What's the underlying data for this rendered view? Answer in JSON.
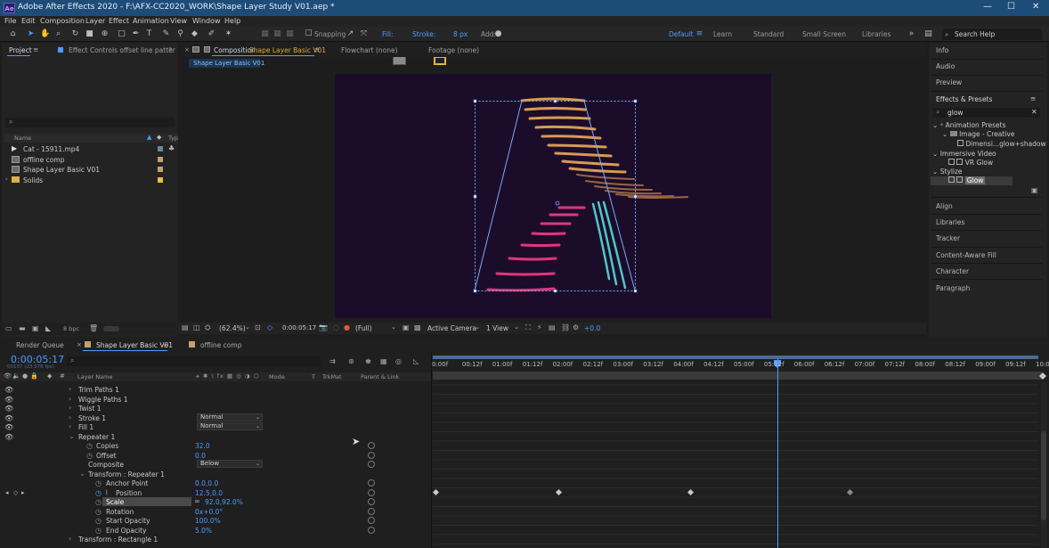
{
  "window": {
    "app_logo": "Ae",
    "title": "Adobe After Effects 2020 - F:\\AFX-CC2020_WORK\\Shape Layer Study V01.aep *"
  },
  "menu": [
    "File",
    "Edit",
    "Composition",
    "Layer",
    "Effect",
    "Animation",
    "View",
    "Window",
    "Help"
  ],
  "toolbar": {
    "snapping": "Snapping",
    "fill": "Fill:",
    "stroke": "Stroke:",
    "stroke_px": "8 px",
    "add": "Add:",
    "workspaces": [
      "Default",
      "Learn",
      "Standard",
      "Small Screen",
      "Libraries"
    ],
    "search_help": "Search Help"
  },
  "project": {
    "tab_project": "Project",
    "tab_effect_controls": "Effect Controls offset line patter",
    "col_name": "Name",
    "col_type": "Typ",
    "items": [
      {
        "name": "Cat - 15911.mp4",
        "color": "#5f8f8f"
      },
      {
        "name": "offline comp",
        "color": "#c7a06e"
      },
      {
        "name": "Shape Layer Basic V01",
        "color": "#c7a06e"
      },
      {
        "name": "Solids",
        "color": "#e3c23c"
      }
    ],
    "bpc": "8 bpc"
  },
  "viewer": {
    "tab_comp_prefix": "Composition",
    "tab_comp_name": "Shape Layer Basic V01",
    "tab_flowchart": "Flowchart (none)",
    "tab_footage": "Footage (none)",
    "breadcrumb": "Shape Layer Basic V01",
    "zoom": "(62.4%)",
    "time": "0:00:05:17",
    "resolution": "(Full)",
    "camera": "Active Camera",
    "view_count": "1 View",
    "exposure": "+0.0"
  },
  "right_panel": {
    "top_items": [
      "Info",
      "Audio",
      "Preview"
    ],
    "effects_title": "Effects & Presets",
    "search_value": "glow",
    "tree": [
      "Animation Presets",
      "Image - Creative",
      "Dimensi...glow+shadow",
      "Immersive Video",
      "VR Glow",
      "Stylize",
      "Glow"
    ],
    "bottom_items": [
      "Align",
      "Libraries",
      "Tracker",
      "Content-Aware Fill",
      "Character",
      "Paragraph"
    ]
  },
  "timeline": {
    "tab_render": "Render Queue",
    "tab_comp": "Shape Layer Basic V01",
    "tab_offline": "offline comp",
    "timecode": "0:00:05:17",
    "fps": "00137 (23.976 fps)",
    "col_layer": "Layer Name",
    "col_mode": "Mode",
    "col_t": "T",
    "col_trkmat": "TrkMat",
    "col_parent": "Parent & Link",
    "rows": [
      {
        "name": "Trim Paths 1"
      },
      {
        "name": "Wiggle Paths 1"
      },
      {
        "name": "Twist 1"
      },
      {
        "name": "Stroke 1",
        "mode": "Normal"
      },
      {
        "name": "Fill 1",
        "mode": "Normal"
      },
      {
        "name": "Repeater 1"
      },
      {
        "name": "Copies",
        "value": "32.0"
      },
      {
        "name": "Offset",
        "value": "0.0"
      },
      {
        "name": "Composite",
        "mode": "Below"
      },
      {
        "name": "Transform : Repeater 1"
      },
      {
        "name": "Anchor Point",
        "value": "0.0,0.0"
      },
      {
        "name": "Position",
        "value": "12.5,0.0"
      },
      {
        "name": "Scale",
        "value": "92.0,92.0%"
      },
      {
        "name": "Rotation",
        "value": "0x+0.0°"
      },
      {
        "name": "Start Opacity",
        "value": "100.0%"
      },
      {
        "name": "End Opacity",
        "value": "5.0%"
      },
      {
        "name": "Transform : Rectangle 1"
      }
    ],
    "ruler": [
      "0:00f",
      "00:12f",
      "01:00f",
      "01:12f",
      "02:00f",
      "02:12f",
      "03:00f",
      "03:12f",
      "04:00f",
      "04:12f",
      "05:00f",
      "05:12f",
      "06:00f",
      "06:12f",
      "07:00f",
      "07:12f",
      "08:00f",
      "08:12f",
      "09:00f",
      "09:12f",
      "10:0"
    ]
  },
  "colors": {
    "accent": "#4d9bff",
    "titlebar": "#1e4c78",
    "comp_bg": "#1b0d29"
  }
}
